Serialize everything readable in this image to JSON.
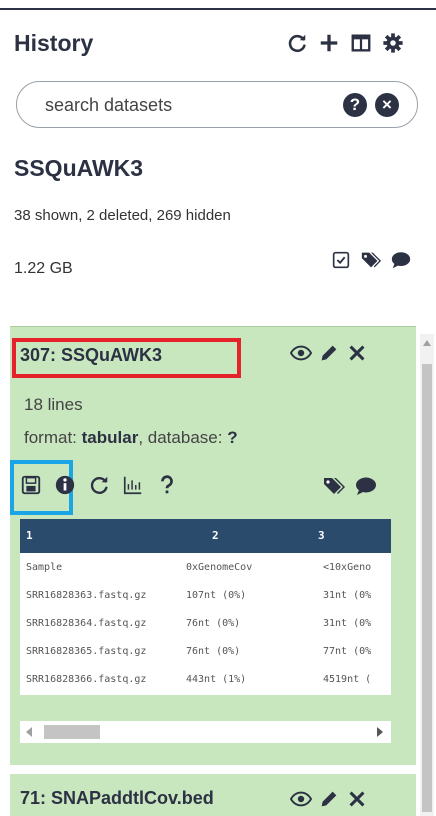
{
  "header": {
    "title": "History",
    "icons": [
      "refresh-icon",
      "plus-icon",
      "columns-icon",
      "gear-icon"
    ]
  },
  "search": {
    "placeholder": "search datasets",
    "help_icon": "?",
    "clear_icon": "×"
  },
  "history": {
    "name": "SSQuAWK3",
    "counts": "38 shown, 2 deleted, 269 hidden",
    "size": "1.22 GB"
  },
  "dataset": {
    "title": "307: SSQuAWK3",
    "lines": "18 lines",
    "format_label": "format:",
    "format_value": "tabular",
    "database_label": ", database:",
    "database_value": "?",
    "highlight_colors": {
      "title_box": "#e5222b",
      "save_box": "#19a5e6"
    },
    "panel_color": "#c9e7bf"
  },
  "peek": {
    "columns": [
      "1",
      "2",
      "3"
    ],
    "rows": [
      [
        "Sample",
        "0xGenomeCov",
        "<10xGeno"
      ],
      [
        "SRR16828363.fastq.gz",
        "107nt (0%)",
        "31nt (0%"
      ],
      [
        "SRR16828364.fastq.gz",
        "76nt (0%)",
        "31nt (0%"
      ],
      [
        "SRR16828365.fastq.gz",
        "76nt (0%)",
        "77nt (0%"
      ],
      [
        "SRR16828366.fastq.gz",
        "443nt (1%)",
        "4519nt ("
      ]
    ]
  },
  "dataset2": {
    "title": "71: SNAPaddtlCov.bed"
  }
}
